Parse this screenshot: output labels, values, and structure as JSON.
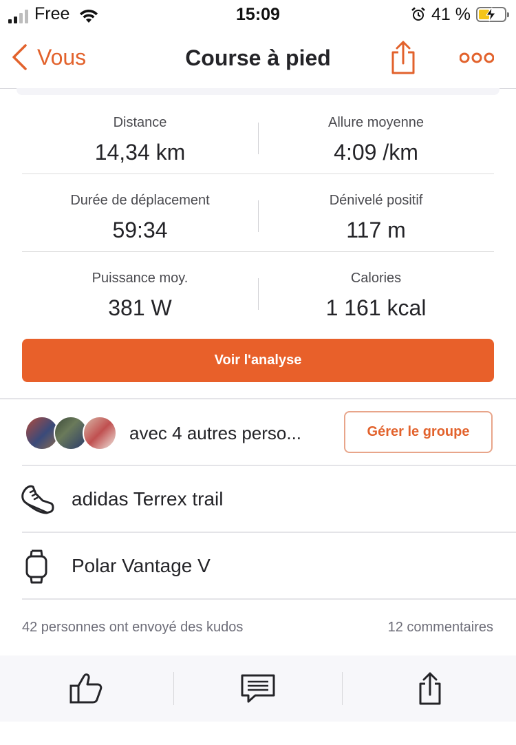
{
  "status_bar": {
    "carrier": "Free",
    "time": "15:09",
    "battery_percent": "41 %",
    "battery_level": 0.41
  },
  "nav": {
    "back_label": "Vous",
    "title": "Course à pied",
    "share_icon": "share-icon",
    "more_icon": "more-icon"
  },
  "stats": [
    {
      "left": {
        "label": "Distance",
        "value": "14,34 km"
      },
      "right": {
        "label": "Allure moyenne",
        "value": "4:09 /km"
      }
    },
    {
      "left": {
        "label": "Durée de déplacement",
        "value": "59:34"
      },
      "right": {
        "label": "Dénivelé positif",
        "value": "117 m"
      }
    },
    {
      "left": {
        "label": "Puissance moy.",
        "value": "381 W"
      },
      "right": {
        "label": "Calories",
        "value": "1 161 kcal"
      }
    }
  ],
  "analyse_button": "Voir l'analyse",
  "group": {
    "text": "avec 4 autres perso...",
    "button": "Gérer le groupe"
  },
  "gear": {
    "shoes": "adidas Terrex trail",
    "device": "Polar Vantage V"
  },
  "social": {
    "kudos": "42 personnes ont envoyé des kudos",
    "comments": "12 commentaires"
  },
  "actions": [
    "kudos-icon",
    "comment-icon",
    "share-icon"
  ],
  "colors": {
    "accent": "#e8602a",
    "text": "#242428",
    "muted": "#6d6d78"
  }
}
